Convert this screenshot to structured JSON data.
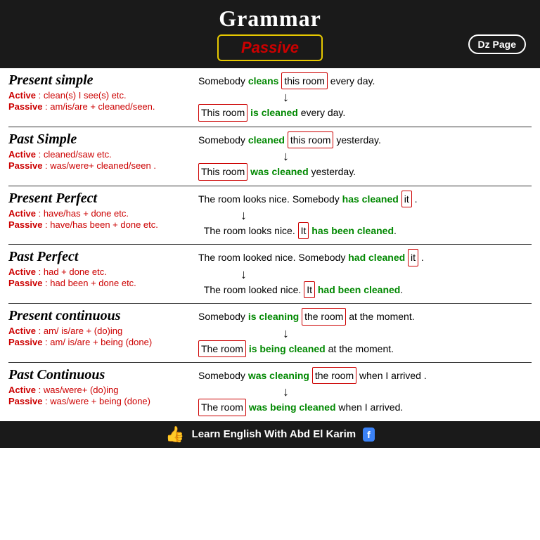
{
  "header": {
    "title": "Grammar",
    "passive_label": "Passive",
    "dz_label": "Dz Page"
  },
  "sections": [
    {
      "id": "present-simple",
      "title": "Present simple",
      "active_text": "Active : clean(s) I see(s) etc.",
      "passive_text": "Passive : am/is/are + cleaned/seen.",
      "example_active": "Somebody cleans this room every day.",
      "example_passive": "This room is cleaned every day."
    },
    {
      "id": "past-simple",
      "title": "Past Simple",
      "active_text": "Active : cleaned/saw etc.",
      "passive_text": "Passive : was/were+ cleaned/seen .",
      "example_active": "Somebody cleaned this room yesterday.",
      "example_passive": "This room was cleaned yesterday."
    },
    {
      "id": "present-perfect",
      "title": "Present Perfect",
      "active_text": "Active : have/has + done etc.",
      "passive_text": "Passive : have/has been + done etc.",
      "example_active": "The room looks nice. Somebody has cleaned it .",
      "example_passive": "The room looks nice. It has been cleaned."
    },
    {
      "id": "past-perfect",
      "title": "Past Perfect",
      "active_text": "Active : had + done etc.",
      "passive_text": "Passive : had been + done etc.",
      "example_active": "The room looked nice. Somebody had cleaned it .",
      "example_passive": "The room looked nice. It had been cleaned."
    },
    {
      "id": "present-continuous",
      "title": "Present continuous",
      "active_text": "Active : am/ is/are + (do)ing",
      "passive_text": "Passive : am/ is/are + being (done)",
      "example_active": "Somebody is cleaning the room at the moment.",
      "example_passive": "The room is being cleaned at the moment."
    },
    {
      "id": "past-continuous",
      "title": "Past Continuous",
      "active_text": "Active : was/were+ (do)ing",
      "passive_text": "Passive : was/were + being (done)",
      "example_active": "Somebody was cleaning the room when I arrived .",
      "example_passive": "The room was being cleaned when I arrived."
    }
  ],
  "footer": {
    "text": "Learn English With Abd El Karim"
  }
}
